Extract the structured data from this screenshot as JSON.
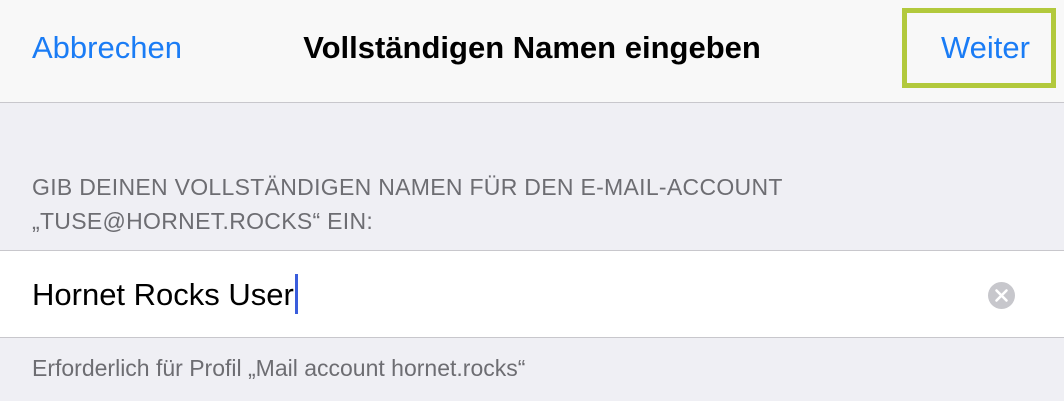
{
  "navbar": {
    "cancel_label": "Abbrechen",
    "title": "Vollständigen Namen eingeben",
    "next_label": "Weiter",
    "highlight_color": "#b2c93c",
    "accent_color": "#1a7cf5"
  },
  "section": {
    "header_line1": "GIB DEINEN VOLLSTÄNDIGEN NAMEN FÜR DEN E-MAIL-ACCOUNT",
    "header_line2": "„TUSE@HORNET.ROCKS“ EIN:"
  },
  "name_field": {
    "value": "Hornet Rocks User",
    "clear_icon": "clear-circle-icon"
  },
  "footer": {
    "note": "Erforderlich für Profil „Mail account hornet.rocks“"
  }
}
